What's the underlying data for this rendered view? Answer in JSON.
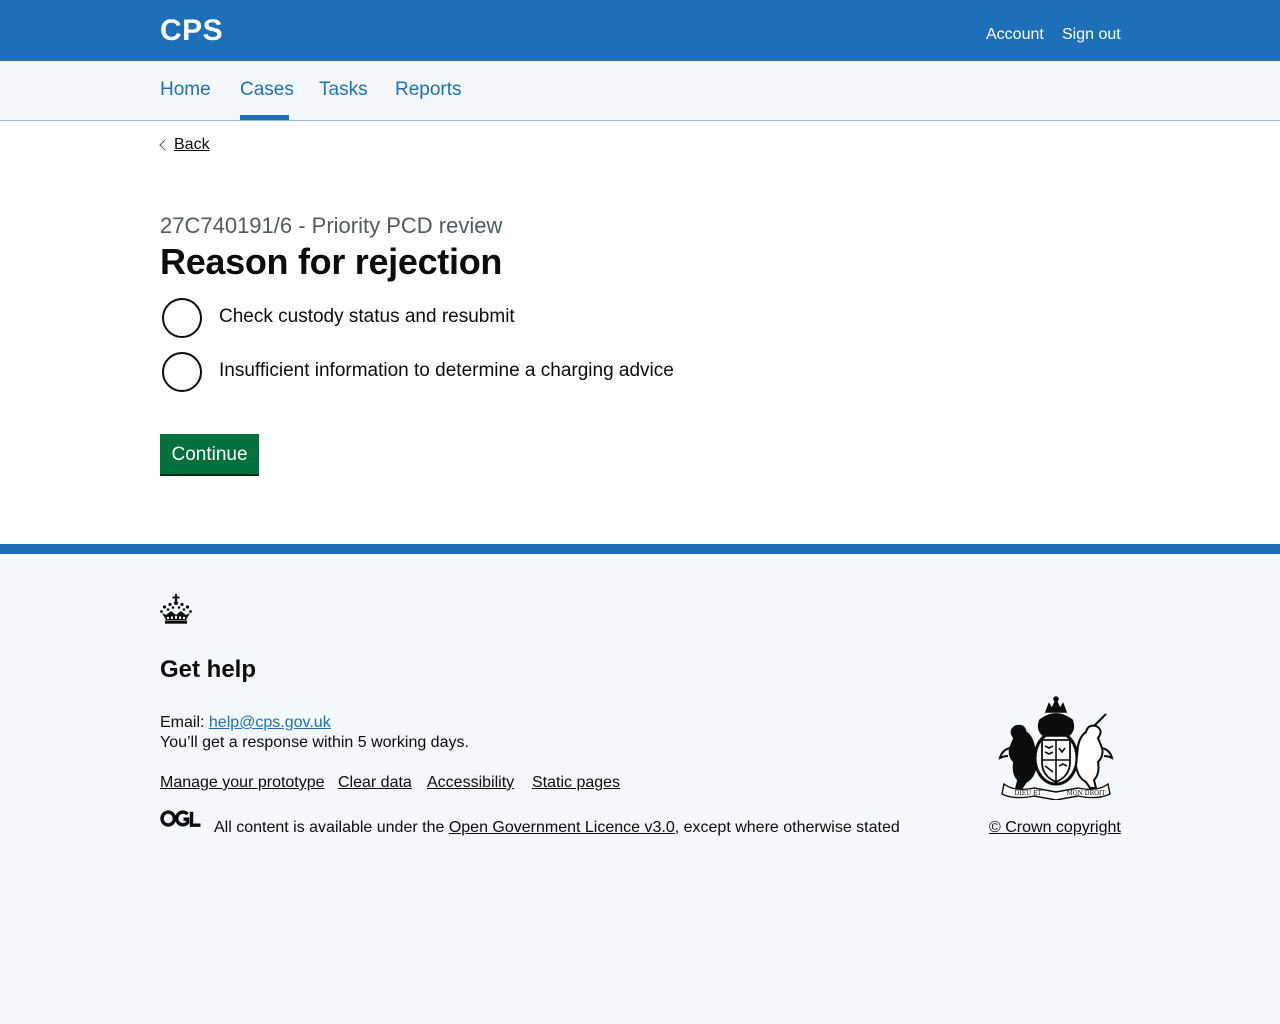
{
  "header": {
    "logo": "CPS",
    "account": "Account",
    "sign_out": "Sign out"
  },
  "nav": {
    "items": [
      {
        "label": "Home"
      },
      {
        "label": "Cases",
        "active": true
      },
      {
        "label": "Tasks"
      },
      {
        "label": "Reports"
      }
    ]
  },
  "main": {
    "back": "Back",
    "caption": "27C740191/6 - Priority PCD review",
    "heading": "Reason for rejection",
    "options": [
      {
        "label": "Check custody status and resubmit",
        "checked": false
      },
      {
        "label": "Insufficient information to determine a charging advice",
        "checked": false
      }
    ],
    "continue": "Continue"
  },
  "footer": {
    "get_help": "Get help",
    "email_label": "Email:",
    "email": "help@cps.gov.uk",
    "response": "You’ll get a response within 5 working days.",
    "links": [
      "Manage your prototype",
      "Clear data",
      "Accessibility",
      "Static pages"
    ],
    "licence_prefix": "All content is available under the",
    "licence_link": "Open Government Licence v3.0",
    "licence_suffix": ", except where otherwise stated",
    "copyright": "© Crown copyright",
    "crest_motto_left": "DIEU ET",
    "crest_motto_right": "MON DROIT"
  },
  "colors": {
    "brand_blue": "#1d70b8",
    "button_green": "#00703c",
    "footer_bg": "#f4f8fb",
    "text": "#0b0c0c",
    "secondary_text": "#505a5f"
  },
  "icons": {
    "crown": "crown-icon",
    "ogl": "ogl-logo",
    "crest": "royal-coat-of-arms",
    "back": "chevron-left-icon"
  }
}
